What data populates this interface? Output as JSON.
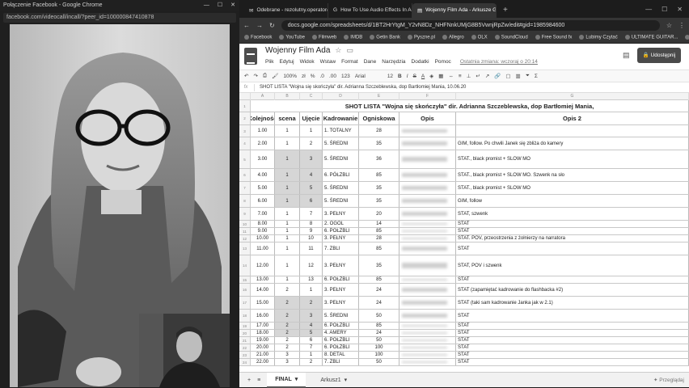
{
  "left_window": {
    "title": "Połączenie Facebook - Google Chrome",
    "url": "facebook.com/videocall/incall/?peer_id=100000847410878"
  },
  "tabs": [
    {
      "label": "Odebrane - rezolutny.operator@"
    },
    {
      "label": "How To Use Audio Effects In Ado"
    },
    {
      "label": "Wojenny Film Ada - Arkusze Goo"
    }
  ],
  "address": "docs.google.com/spreadsheets/d/1BT2HrYtgM_Y2vN8Dz_NHFNnkUMjG8B5VwnjRpZw/edit#gid=1985984600",
  "bookmarks": [
    "Facebook",
    "YouTube",
    "Filmweb",
    "IMDB",
    "Getin Bank",
    "Pyszne.pl",
    "Allegro",
    "OLX",
    "SoundCloud",
    "Free Sound fx",
    "Lubimy Czytać",
    "ULTIMATE GUITAR...",
    "Pinterest"
  ],
  "doc": {
    "title": "Wojenny Film Ada",
    "menu": [
      "Plik",
      "Edytuj",
      "Widok",
      "Wstaw",
      "Format",
      "Dane",
      "Narzędzia",
      "Dodatki",
      "Pomoc"
    ],
    "last_edit": "Ostatnia zmiana: wczoraj o 20:14",
    "share": "Udostępnij"
  },
  "toolbar": {
    "zoom": "100%",
    "currency": "zł",
    "pct": "%",
    "dec0": ".0",
    "dec00": ".00",
    "fmt": "123",
    "font": "Arial",
    "size": "12",
    "bold": "B",
    "italic": "I",
    "strike": "S",
    "color": "A"
  },
  "formula": {
    "fx": "fx",
    "text": "SHOT LISTA \"Wojna się skończyła\" dir. Adrianna Szczeblewska, dop Bartłomiej Mania, 10.06.20"
  },
  "columns": [
    "A",
    "B",
    "C",
    "D",
    "E",
    "F",
    "G"
  ],
  "sheet_title": "SHOT LISTA \"Wojna się skończyła\" dir. Adrianna Szczeblewska, dop Bartłomiej Mania,",
  "headers": [
    "Kolejność",
    "scena",
    "Ujęcie",
    "Kadrowanie",
    "Ogniskowa",
    "Opis",
    "Opis 2"
  ],
  "rows": [
    {
      "n": "3",
      "k": "1.00",
      "s": "1",
      "u": "1",
      "kad": "1. TOTALNY",
      "o": "28",
      "op2": ""
    },
    {
      "n": "4",
      "k": "2.00",
      "s": "1",
      "u": "2",
      "kad": "5. ŚREDNI",
      "o": "35",
      "op2": "GIM, follow. Po chwili Janek się zbliża do kamery"
    },
    {
      "n": "5",
      "k": "3.00",
      "s": "1",
      "u": "3",
      "kad": "5. ŚREDNI",
      "o": "36",
      "op2": "STAT., black promist + SLOW MO"
    },
    {
      "n": "6",
      "k": "4.00",
      "s": "1",
      "u": "4",
      "kad": "6. PÓŁZBLI",
      "o": "85",
      "op2": "STAT., black promist + SLOW MO. Szwenk na sło"
    },
    {
      "n": "7",
      "k": "5.00",
      "s": "1",
      "u": "5",
      "kad": "5. ŚREDNI",
      "o": "35",
      "op2": "STAT., black promist + SLOW MO"
    },
    {
      "n": "8",
      "k": "6.00",
      "s": "1",
      "u": "6",
      "kad": "5. ŚREDNI",
      "o": "35",
      "op2": "GIM, follow"
    },
    {
      "n": "9",
      "k": "7.00",
      "s": "1",
      "u": "7",
      "kad": "3. PEŁNY",
      "o": "20",
      "op2": "STAT, szwenk"
    },
    {
      "n": "10",
      "k": "8.00",
      "s": "1",
      "u": "8",
      "kad": "2. OGÓL",
      "o": "14",
      "op2": "STAT"
    },
    {
      "n": "11",
      "k": "9.00",
      "s": "1",
      "u": "9",
      "kad": "6. PÓŁZBLI",
      "o": "85",
      "op2": "STAT"
    },
    {
      "n": "12",
      "k": "10.00",
      "s": "1",
      "u": "10",
      "kad": "3. PEŁNY",
      "o": "28",
      "op2": "STAT. POV, przeostrzenia z żołnierzy na narratora"
    },
    {
      "n": "13",
      "k": "11.00",
      "s": "1",
      "u": "11",
      "kad": "7. ZBLI",
      "o": "85",
      "op2": "STAT"
    },
    {
      "n": "14",
      "k": "12.00",
      "s": "1",
      "u": "12",
      "kad": "3. PEŁNY",
      "o": "35",
      "op2": "STAT, POV i szwenk"
    },
    {
      "n": "15",
      "k": "13.00",
      "s": "1",
      "u": "13",
      "kad": "6. PÓŁZBLI",
      "o": "85",
      "op2": "STAT"
    },
    {
      "n": "16",
      "k": "14.00",
      "s": "2",
      "u": "1",
      "kad": "3. PEŁNY",
      "o": "24",
      "op2": "STAT (zapamiętać kadrowanie do flashbacka #2)"
    },
    {
      "n": "17",
      "k": "15.00",
      "s": "2",
      "u": "2",
      "kad": "3. PEŁNY",
      "o": "24",
      "op2": "STAT (taki sam kadrowanie Janka jak w 2.1)"
    },
    {
      "n": "18",
      "k": "16.00",
      "s": "2",
      "u": "3",
      "kad": "5. ŚREDNI",
      "o": "50",
      "op2": "STAT"
    },
    {
      "n": "19",
      "k": "17.00",
      "s": "2",
      "u": "4",
      "kad": "6. PÓŁZBLI",
      "o": "85",
      "op2": "STAT"
    },
    {
      "n": "20",
      "k": "18.00",
      "s": "2",
      "u": "5",
      "kad": "4. AMERY",
      "o": "24",
      "op2": "STAT"
    },
    {
      "n": "21",
      "k": "19.00",
      "s": "2",
      "u": "6",
      "kad": "6. PÓŁZBLI",
      "o": "50",
      "op2": "STAT"
    },
    {
      "n": "22",
      "k": "20.00",
      "s": "2",
      "u": "7",
      "kad": "6. PÓŁZBLI",
      "o": "100",
      "op2": "STAT"
    },
    {
      "n": "23",
      "k": "21.00",
      "s": "3",
      "u": "1",
      "kad": "8. DETAL",
      "o": "100",
      "op2": "STAT"
    },
    {
      "n": "24",
      "k": "22.00",
      "s": "3",
      "u": "2",
      "kad": "7. ZBLI",
      "o": "50",
      "op2": "STAT"
    }
  ],
  "sheet_tabs": [
    "FINAL",
    "Arkusz1"
  ],
  "explore": "Przeglądaj"
}
